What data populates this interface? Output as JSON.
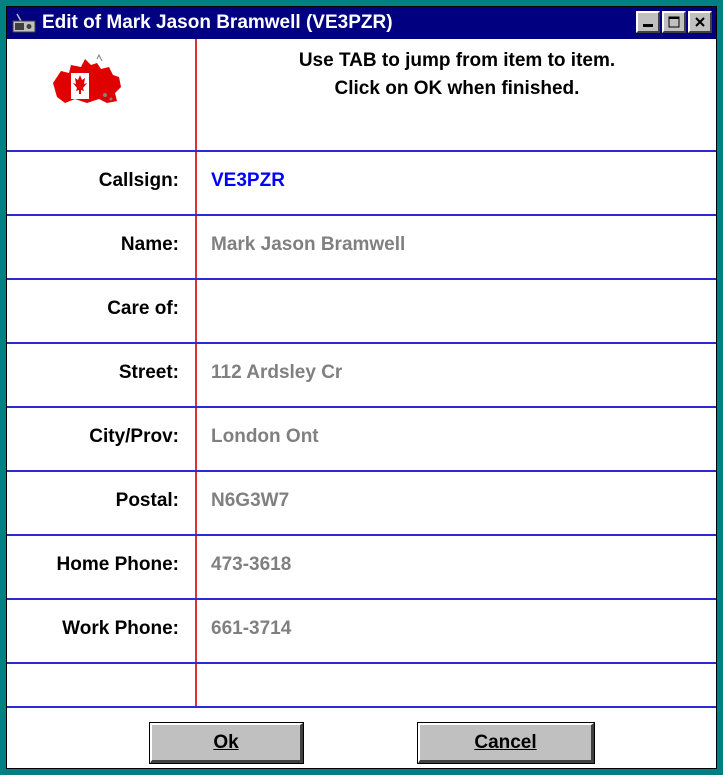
{
  "window": {
    "title": "Edit of Mark Jason Bramwell (VE3PZR)",
    "buttons": {
      "minimize": "▁",
      "maximize": "☐",
      "close": "✕"
    }
  },
  "instructions": {
    "line1": "Use TAB to jump from item to item.",
    "line2": "Click on OK when finished."
  },
  "fields": [
    {
      "label": "Callsign:",
      "value": "VE3PZR"
    },
    {
      "label": "Name:",
      "value": "Mark Jason Bramwell"
    },
    {
      "label": "Care of:",
      "value": ""
    },
    {
      "label": "Street:",
      "value": "112 Ardsley Cr"
    },
    {
      "label": "City/Prov:",
      "value": "London Ont"
    },
    {
      "label": "Postal:",
      "value": "N6G3W7"
    },
    {
      "label": "Home Phone:",
      "value": "473-3618"
    },
    {
      "label": "Work Phone:",
      "value": "661-3714"
    }
  ],
  "actions": {
    "ok_label": "Ok",
    "cancel_label": "Cancel"
  },
  "colors": {
    "titlebar": "#000080",
    "frame": "#008080",
    "callsign_text": "#0000ff",
    "value_text": "#808080",
    "row_divider": "#2a2ad8",
    "column_divider": "#e03030"
  },
  "icons": {
    "system_menu": "radio-icon",
    "flag": "canada-map-flag-icon"
  }
}
